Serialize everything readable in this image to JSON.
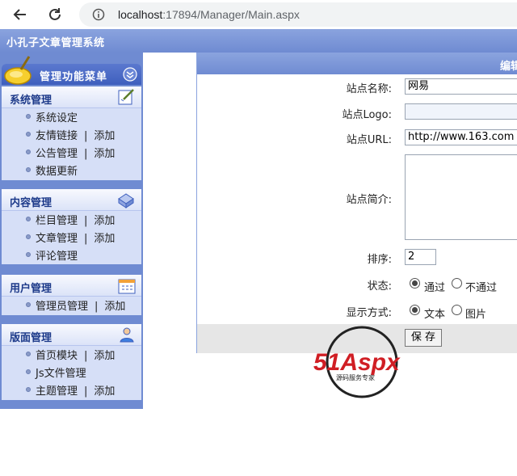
{
  "browser": {
    "url_host": "localhost",
    "url_rest": ":17894/Manager/Main.aspx"
  },
  "app": {
    "title": "小孔子文章管理系统"
  },
  "menu": {
    "title": "管理功能菜单",
    "groups": [
      {
        "title": "系统管理",
        "items": [
          {
            "label": "系统设定"
          },
          {
            "label": "友情链接",
            "extra": "添加"
          },
          {
            "label": "公告管理",
            "extra": "添加"
          },
          {
            "label": "数据更新"
          }
        ]
      },
      {
        "title": "内容管理",
        "items": [
          {
            "label": "栏目管理",
            "extra": "添加"
          },
          {
            "label": "文章管理",
            "extra": "添加"
          },
          {
            "label": "评论管理"
          }
        ]
      },
      {
        "title": "用户管理",
        "items": [
          {
            "label": "管理员管理",
            "extra": "添加"
          }
        ]
      },
      {
        "title": "版面管理",
        "items": [
          {
            "label": "首页模块",
            "extra": "添加"
          },
          {
            "label": "Js文件管理"
          },
          {
            "label": "主题管理",
            "extra": "添加"
          }
        ]
      }
    ],
    "separator": "|"
  },
  "form": {
    "header_title": "编辑",
    "site_name_label": "站点名称:",
    "site_name_value": "网易",
    "site_logo_label": "站点Logo:",
    "site_logo_value": "",
    "site_url_label": "站点URL:",
    "site_url_value": "http://www.163.com",
    "site_intro_label": "站点简介:",
    "site_intro_value": "",
    "sort_label": "排序:",
    "sort_value": "2",
    "status_label": "状态:",
    "status_options": [
      "通过",
      "不通过"
    ],
    "status_selected": "通过",
    "display_label": "显示方式:",
    "display_options": [
      "文本",
      "图片"
    ],
    "display_selected": "文本",
    "save_label": "保 存"
  },
  "watermark": {
    "brand": "51Aspx",
    "tagline": "源码服务专家"
  },
  "colors": {
    "header_blue": "#6f8bd2",
    "menu_bg": "#d6dff7",
    "group_title": "#1d3a8a"
  }
}
